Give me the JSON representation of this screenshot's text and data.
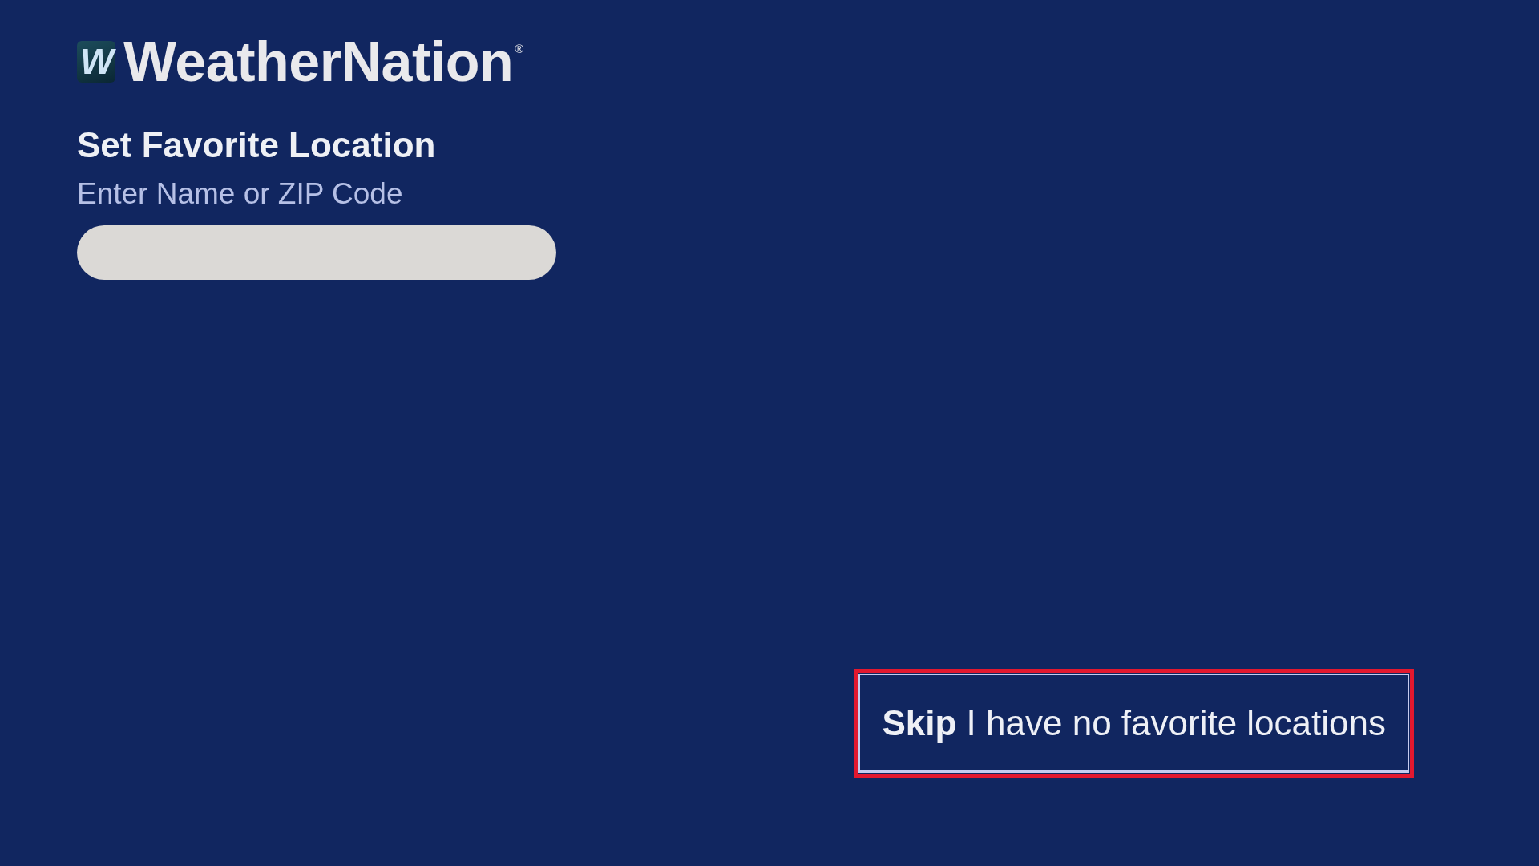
{
  "logo": {
    "mark": "W",
    "name": "WeatherNation$^{®}$"
  },
  "heading": "Set Favorite Location",
  "search": {
    "label": "Enter Name or ZIP Code"
  },
  "skip_button": {
    "label": "**Skip** I have no favorite locations",
    "focused": true
  }
}
